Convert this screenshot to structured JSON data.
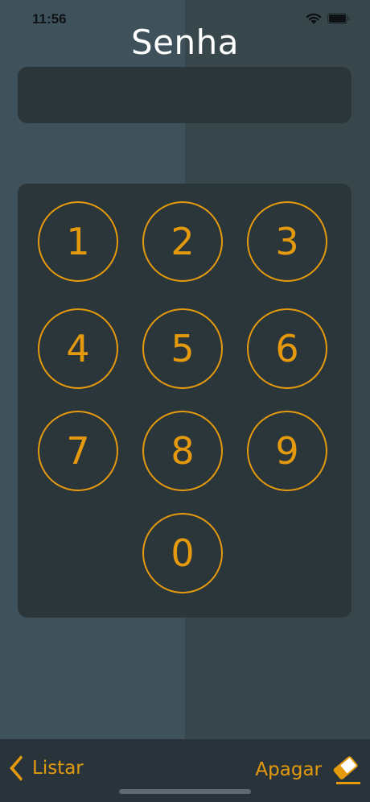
{
  "status_bar": {
    "time": "11:56"
  },
  "header": {
    "title": "Senha"
  },
  "password": {
    "value": ""
  },
  "keypad": {
    "keys": [
      "1",
      "2",
      "3",
      "4",
      "5",
      "6",
      "7",
      "8",
      "9",
      "0"
    ]
  },
  "bottom_bar": {
    "list_label": "Listar",
    "erase_label": "Apagar"
  },
  "colors": {
    "accent": "#e59a0e",
    "panel": "#2b363b",
    "background_left": "#3f525b",
    "background_right": "#38474c",
    "bottom_bar": "#28343a"
  }
}
